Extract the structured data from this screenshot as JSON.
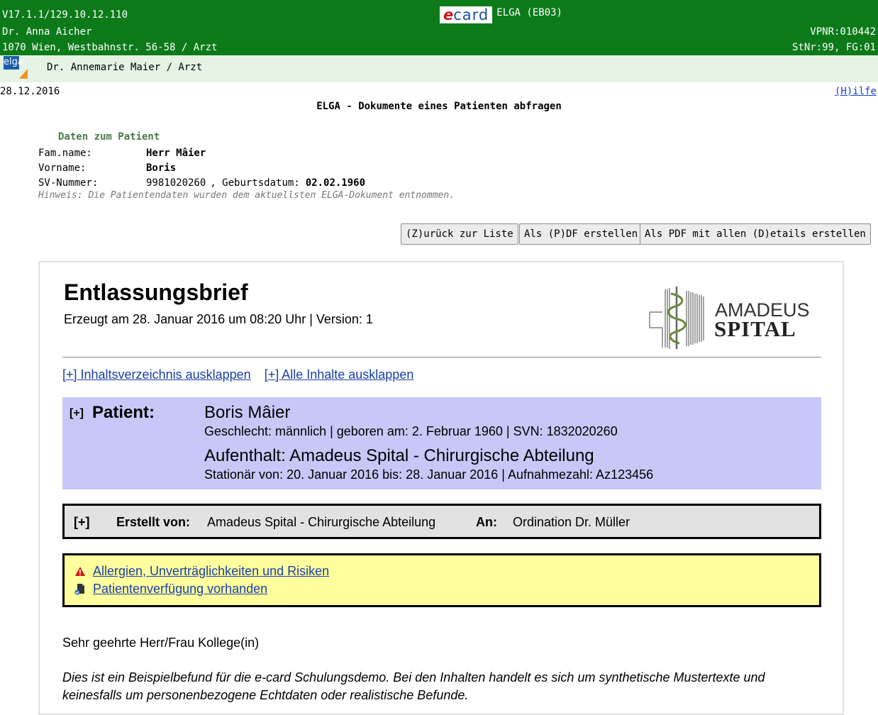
{
  "header": {
    "version": "V17.1.1/129.10.12.110",
    "doctor": "Dr. Anna Aicher",
    "address": "1070 Wien, Westbahnstr. 56-58 / Arzt",
    "ecard_e": "e",
    "ecard_card": "card",
    "app": "ELGA (EB03)",
    "vpnr": "VPNR:010442",
    "stnr": "StNr:99, FG:01"
  },
  "userbar": {
    "logo": "elga",
    "user": "Dr. Annemarie Maier / Arzt"
  },
  "date": "28.12.2016",
  "help": "(H)ilfe",
  "page_title": "ELGA - Dokumente eines Patienten abfragen",
  "patient": {
    "heading": "Daten zum Patient",
    "famname_label": "Fam.name:",
    "famname": "Herr Mâier",
    "vorname_label": "Vorname:",
    "vorname": "Boris",
    "svnr_label": "SV-Nummer:",
    "svnr": "9981020260",
    "birth_label": ", Geburtsdatum:",
    "birth": "02.02.1960",
    "hint": "Hinweis: Die Patientendaten wurden dem aktuellsten ELGA-Dokument entnommen."
  },
  "buttons": {
    "back": "(Z)urück zur Liste",
    "pdf": "Als (P)DF erstellen",
    "pdf_details": "Als PDF mit allen (D)etails erstellen"
  },
  "document": {
    "title": "Entlassungsbrief",
    "created": "Erzeugt am 28. Januar 2016 um 08:20 Uhr | Version: 1",
    "logo_line1": "AMADEUS",
    "logo_line2": "SPITAL",
    "toggle_toc": "[+] Inhaltsverzeichnis ausklappen",
    "toggle_all": "[+] Alle Inhalte ausklappen",
    "patient_plus": "[+]",
    "patient_label": "Patient:",
    "patient_name": "Boris Mâier",
    "patient_info": "Geschlecht: männlich | geboren am: 2. Februar 1960 | SVN: 1832020260",
    "stay": "Aufenthalt:  Amadeus Spital - Chirurgische Abteilung",
    "stay_info": "Stationär von: 20. Januar 2016 bis: 28. Januar 2016 | Aufnahmezahl: Az123456",
    "author_plus": "[+]",
    "author_label": "Erstellt von:",
    "author": "Amadeus Spital - Chirurgische Abteilung",
    "to_label": "An:",
    "to": "Ordination Dr. Müller",
    "warn_allergies": "Allergien, Unverträglichkeiten und Risiken",
    "warn_directive": "Patientenverfügung vorhanden",
    "greeting": "Sehr geehrte Herr/Frau Kollege(in)",
    "intro": "Dies ist ein Beispielbefund für die e-card Schulungsdemo. Bei den Inhalten handelt es sich um synthetische Mustertexte und keinesfalls um personenbezogene Echtdaten oder realistische Befunde."
  },
  "colors": {
    "header_green": "#0d7a1a",
    "userbar": "#e4f3e4",
    "patient_box": "#c8c8f8",
    "warn_box": "#ffff9e",
    "link": "#1a3fa6"
  }
}
